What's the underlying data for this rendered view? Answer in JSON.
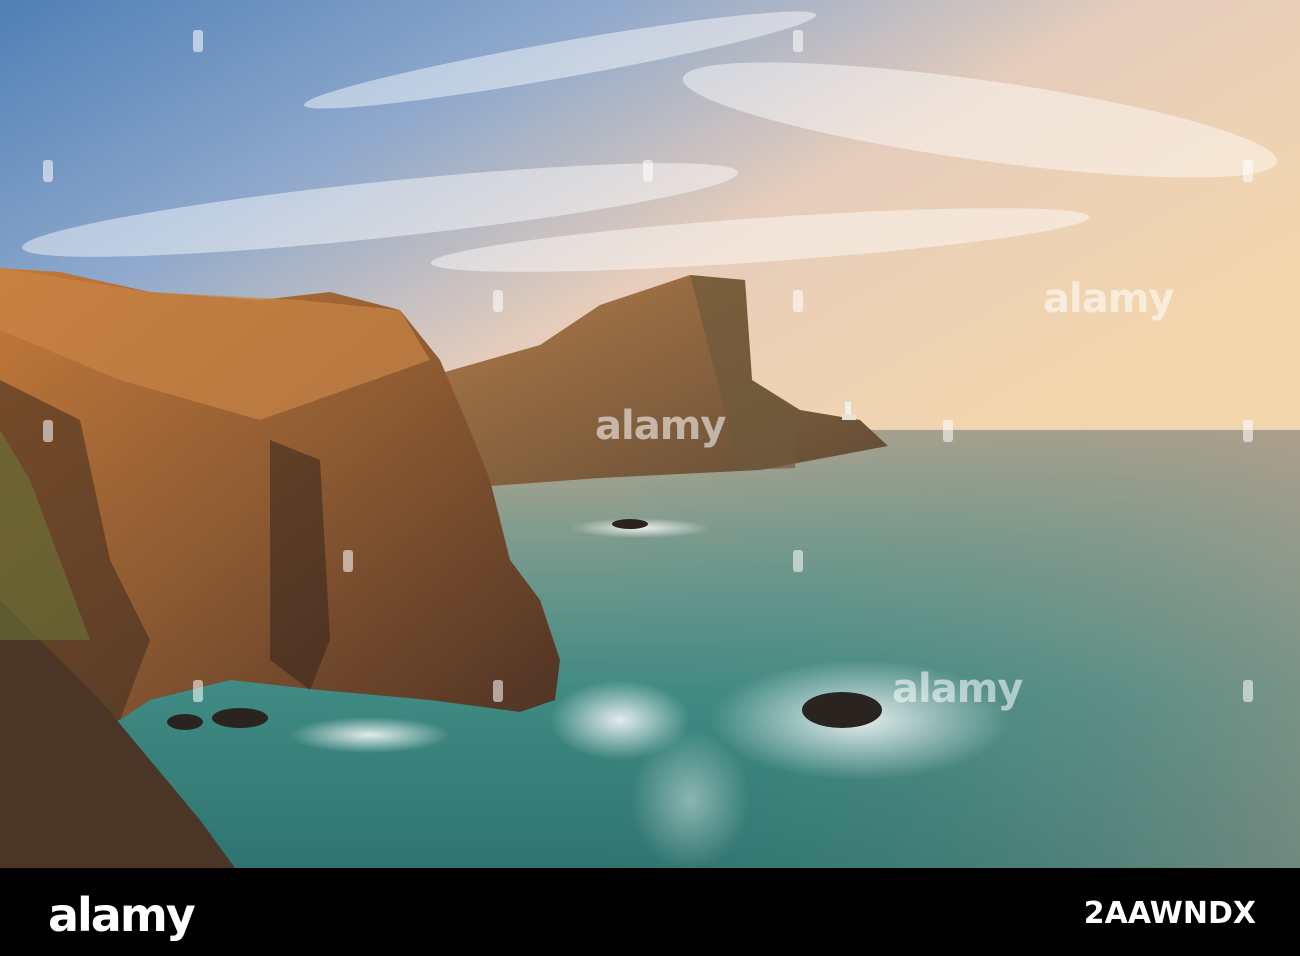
{
  "footer": {
    "brand": "alamy",
    "image_id": "2AAWNDX"
  },
  "watermark": {
    "text": "alamy"
  },
  "colors": {
    "sky_top": "#5a86b8",
    "sky_warm": "#f1d6b2",
    "sea": "#3f8e86",
    "cliff": "#a7632f",
    "footer_bg": "#000000"
  }
}
